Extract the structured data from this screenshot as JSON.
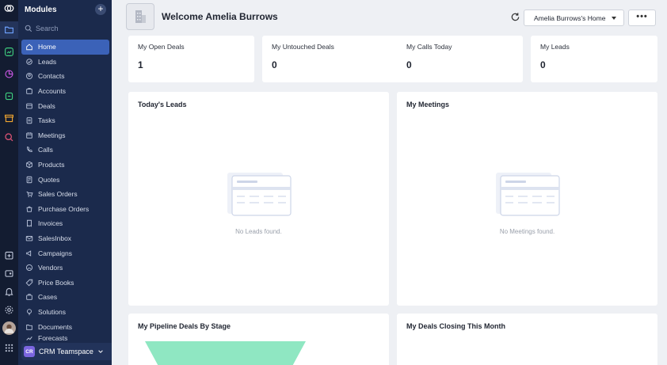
{
  "sidebar": {
    "title": "Modules",
    "search_placeholder": "Search",
    "items": [
      {
        "label": "Home",
        "icon": "home-icon"
      },
      {
        "label": "Leads",
        "icon": "leads-icon"
      },
      {
        "label": "Contacts",
        "icon": "contacts-icon"
      },
      {
        "label": "Accounts",
        "icon": "accounts-icon"
      },
      {
        "label": "Deals",
        "icon": "deals-icon"
      },
      {
        "label": "Tasks",
        "icon": "tasks-icon"
      },
      {
        "label": "Meetings",
        "icon": "meetings-icon"
      },
      {
        "label": "Calls",
        "icon": "phone-icon"
      },
      {
        "label": "Products",
        "icon": "products-icon"
      },
      {
        "label": "Quotes",
        "icon": "quotes-icon"
      },
      {
        "label": "Sales Orders",
        "icon": "sales-orders-icon"
      },
      {
        "label": "Purchase Orders",
        "icon": "purchase-orders-icon"
      },
      {
        "label": "Invoices",
        "icon": "invoices-icon"
      },
      {
        "label": "SalesInbox",
        "icon": "salesinbox-icon"
      },
      {
        "label": "Campaigns",
        "icon": "campaigns-icon"
      },
      {
        "label": "Vendors",
        "icon": "vendors-icon"
      },
      {
        "label": "Price Books",
        "icon": "price-books-icon"
      },
      {
        "label": "Cases",
        "icon": "cases-icon"
      },
      {
        "label": "Solutions",
        "icon": "solutions-icon"
      },
      {
        "label": "Documents",
        "icon": "documents-icon"
      },
      {
        "label": "Forecasts",
        "icon": "forecasts-icon"
      }
    ],
    "teamspace": {
      "badge": "CR",
      "label": "CRM Teamspace"
    }
  },
  "header": {
    "welcome": "Welcome Amelia Burrows",
    "home_select": "Amelia Burrows's Home",
    "more": "•••"
  },
  "stats": [
    {
      "label": "My Open Deals",
      "value": "1"
    },
    {
      "label": "My Untouched Deals",
      "value": "0"
    },
    {
      "label": "My Calls Today",
      "value": "0"
    },
    {
      "label": "My Leads",
      "value": "0"
    }
  ],
  "panels": {
    "todays_leads": {
      "title": "Today's Leads",
      "empty": "No Leads found."
    },
    "my_meetings": {
      "title": "My Meetings",
      "empty": "No Meetings found."
    },
    "pipeline": {
      "title": "My Pipeline Deals By Stage"
    },
    "closing": {
      "title": "My Deals Closing This Month"
    }
  },
  "colors": {
    "rail_bg": "#131c31",
    "sidebar_bg": "#1b2a4c",
    "active_item": "#3b62b8",
    "funnel": "#8fe7c2"
  }
}
